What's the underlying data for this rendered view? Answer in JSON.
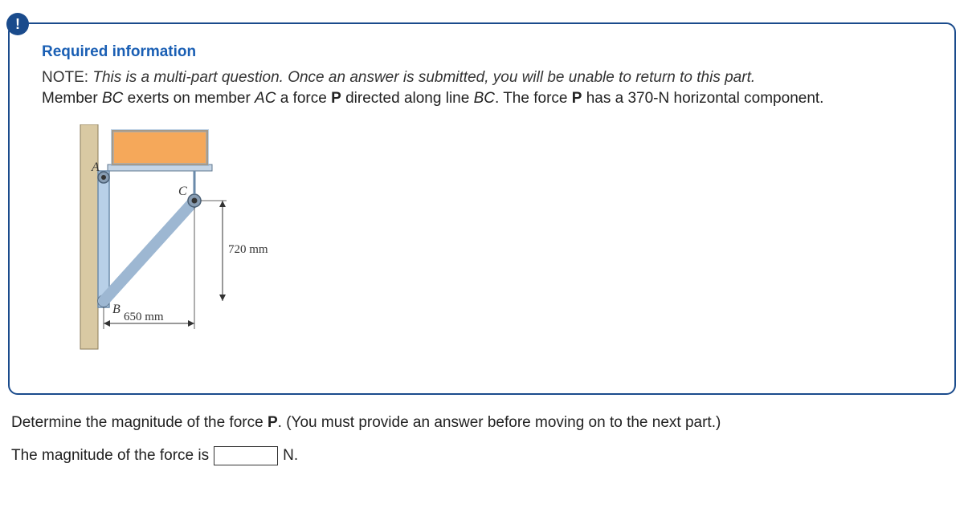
{
  "alert_symbol": "!",
  "heading": "Required information",
  "note_label": "NOTE:",
  "note_text": "This is a multi-part question. Once an answer is submitted, you will be unable to return to this part.",
  "body_prefix": "Member ",
  "body_BC": "BC",
  "body_mid1": " exerts on member ",
  "body_AC": "AC",
  "body_mid2": " a force ",
  "body_P1": "P",
  "body_mid3": " directed along line ",
  "body_BC2": "BC",
  "body_mid4": ". The force ",
  "body_P2": "P",
  "body_end": " has a 370-N horizontal component.",
  "figure": {
    "label_A": "A",
    "label_B": "B",
    "label_C": "C",
    "dim_v": "720 mm",
    "dim_h": "650 mm"
  },
  "prompt_pre": "Determine the magnitude of the force ",
  "prompt_P": "P",
  "prompt_post": ". (You must provide an answer before moving on to the next part.)",
  "answer_pre": "The magnitude of the force is",
  "answer_value": "",
  "answer_unit": "N."
}
